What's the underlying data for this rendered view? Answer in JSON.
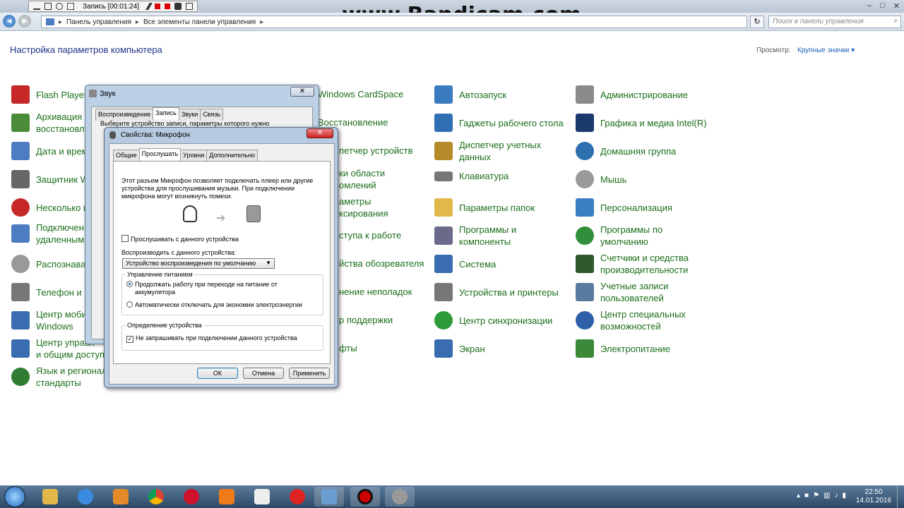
{
  "recorder": {
    "status": "Запись [00:01:24]",
    "watermark": "www.Bandicam.com"
  },
  "window_controls": {
    "minimize": "‒",
    "maximize": "□",
    "close": "✕"
  },
  "address_bar": {
    "back": "◄",
    "forward": "►",
    "crumbs": [
      "Панель управления",
      "Все элементы панели управления"
    ],
    "refresh": "↻",
    "search_placeholder": "Поиск в панели управления",
    "search_icon": "⌕"
  },
  "header": {
    "title": "Настройка параметров компьютера",
    "view_by_label": "Просмотр:",
    "view_by_value": "Крупные значки ▾"
  },
  "items": {
    "col1": [
      {
        "label": "Flash Player",
        "icon": "flash-icon",
        "color": "#c62828"
      },
      {
        "label": "Архивация и\nвосстановле",
        "icon": "backup-icon",
        "color": "#4a8c3a"
      },
      {
        "label": "Дата и время",
        "icon": "datetime-icon",
        "color": "#4d7cc1"
      },
      {
        "label": "Защитник W",
        "icon": "defender-icon",
        "color": "#666666"
      },
      {
        "label": "Несколько п",
        "icon": "misc-icon",
        "color": "#c62828"
      },
      {
        "label": "Подключени\nудаленным р",
        "icon": "remote-icon",
        "color": "#4d7cc1"
      },
      {
        "label": "Распознаван",
        "icon": "speech-icon",
        "color": "#999999"
      },
      {
        "label": "Телефон и м",
        "icon": "phone-icon",
        "color": "#777777"
      },
      {
        "label": "Центр мобиль\nWindows",
        "icon": "mobility-icon",
        "color": "#3a6db0"
      },
      {
        "label": "Центр управл\nи общим доступо",
        "icon": "network-icon",
        "color": "#3a6db0"
      },
      {
        "label": "Язык и региональные\nстандарты",
        "icon": "region-icon",
        "color": "#2e7d32"
      }
    ],
    "col2": [
      {
        "label": "Windows CardSpace",
        "icon": "cardspace-icon"
      },
      {
        "label": "Восстановление",
        "icon": "recovery-icon"
      },
      {
        "label": "Диспетчер устройств",
        "icon": "devmgr-icon"
      },
      {
        "label": "Значки области\nуведомлений",
        "icon": "tray-icon"
      },
      {
        "label": "Параметры\nиндексирования",
        "icon": "index-icon"
      },
      {
        "label": "Центр поддержки",
        "icon": "support-icon"
      },
      {
        "label": "Свойства обозревателя",
        "icon": "ie-icon"
      },
      {
        "label": "Устранение неполадок",
        "icon": "troubleshoot-icon"
      },
      {
        "label": "Центр поддержки",
        "icon": "action-icon"
      },
      {
        "label": "Шрифты",
        "icon": "fonts-icon"
      }
    ],
    "col2_visible": [
      "Windows CardSpace",
      "Восстановление",
      "петчер устройств",
      "ки области\nомлений",
      "аметры\nксирования",
      "ступа к работе",
      "йства обозревателя",
      "нение неполадок",
      "р поддержки",
      "фты"
    ],
    "col3": [
      {
        "label": "Автозапуск",
        "icon": "autoplay-icon",
        "color": "#3b7bbf"
      },
      {
        "label": "Гаджеты рабочего стола",
        "icon": "gadgets-icon",
        "color": "#2f6fb3"
      },
      {
        "label": "Диспетчер учетных\nданных",
        "icon": "credentials-icon",
        "color": "#b58b2a"
      },
      {
        "label": "Клавиатура",
        "icon": "keyboard-icon",
        "color": "#777777"
      },
      {
        "label": "Параметры папок",
        "icon": "folder-options-icon",
        "color": "#e0b94a"
      },
      {
        "label": "Программы и\nкомпоненты",
        "icon": "programs-icon",
        "color": "#6a6a8a"
      },
      {
        "label": "Система",
        "icon": "system-icon",
        "color": "#3a6db0"
      },
      {
        "label": "Устройства и принтеры",
        "icon": "printers-icon",
        "color": "#777777"
      },
      {
        "label": "Центр синхронизации",
        "icon": "sync-icon",
        "color": "#2e9b3a"
      },
      {
        "label": "Экран",
        "icon": "display-icon",
        "color": "#3a6db0"
      }
    ],
    "col4": [
      {
        "label": "Администрирование",
        "icon": "admin-icon",
        "color": "#8a8a8a"
      },
      {
        "label": "Графика и медиа Intel(R)",
        "icon": "intel-icon",
        "color": "#1b3a6b"
      },
      {
        "label": "Домашняя группа",
        "icon": "homegroup-icon",
        "color": "#2e6fb0"
      },
      {
        "label": "Мышь",
        "icon": "mouse-icon",
        "color": "#9a9a9a"
      },
      {
        "label": "Персонализация",
        "icon": "personalize-icon",
        "color": "#3a7fc0"
      },
      {
        "label": "Программы по\nумолчанию",
        "icon": "default-programs-icon",
        "color": "#2f8f3a"
      },
      {
        "label": "Счетчики и средства\nпроизводительности",
        "icon": "perf-icon",
        "color": "#2e5a2e"
      },
      {
        "label": "Учетные записи\nпользователей",
        "icon": "users-icon",
        "color": "#5a7aa0"
      },
      {
        "label": "Центр специальных\nвозможностей",
        "icon": "ease-icon",
        "color": "#2e5fa8"
      },
      {
        "label": "Электропитание",
        "icon": "power-icon",
        "color": "#3a8a3a"
      }
    ]
  },
  "sound_dialog": {
    "title": "Звук",
    "tabs": [
      "Воспроизведение",
      "Запись",
      "Звуки",
      "Связь"
    ],
    "active_tab": "Запись",
    "hint": "Выберите устройство записи, параметры которого нужно",
    "close": "✕"
  },
  "mic_dialog": {
    "title": "Свойства: Микрофон",
    "close": "✕",
    "tabs": [
      "Общие",
      "Прослушать",
      "Уровни",
      "Дополнительно"
    ],
    "active_tab": "Прослушать",
    "description": "Этот разъем Микрофон позволяет подключать плеер или другие\nустройства для прослушивания музыки. При подключении\nмикрофона могут возникнуть помехи.",
    "listen_checkbox": "Прослушивать с данного устройства",
    "listen_checked": false,
    "playback_label": "Воспроизводить с данного устройства:",
    "playback_value": "Устройство воспроизведения по умолчанию",
    "power_group": "Управление питанием",
    "power_opt1": "Продолжать работу при переходе на питание от\nаккумулятора",
    "power_opt2": "Автоматически отключать для экономии электроэнергии",
    "power_selected": 1,
    "detect_group": "Определение устройства",
    "detect_checkbox": "Не запрашивать при подключении данного устройства",
    "detect_checked": true,
    "ok": "ОК",
    "cancel": "Отмена",
    "apply": "Применить"
  },
  "taskbar": {
    "apps": [
      "explorer-icon",
      "ie-icon",
      "media-icon",
      "chrome-icon",
      "opera-icon",
      "avast-icon",
      "yandex-icon",
      "yandex-browser-icon",
      "control-panel-icon",
      "bandicam-icon",
      "sound-icon"
    ],
    "clock_time": "22:50",
    "clock_date": "14.01.2016"
  }
}
